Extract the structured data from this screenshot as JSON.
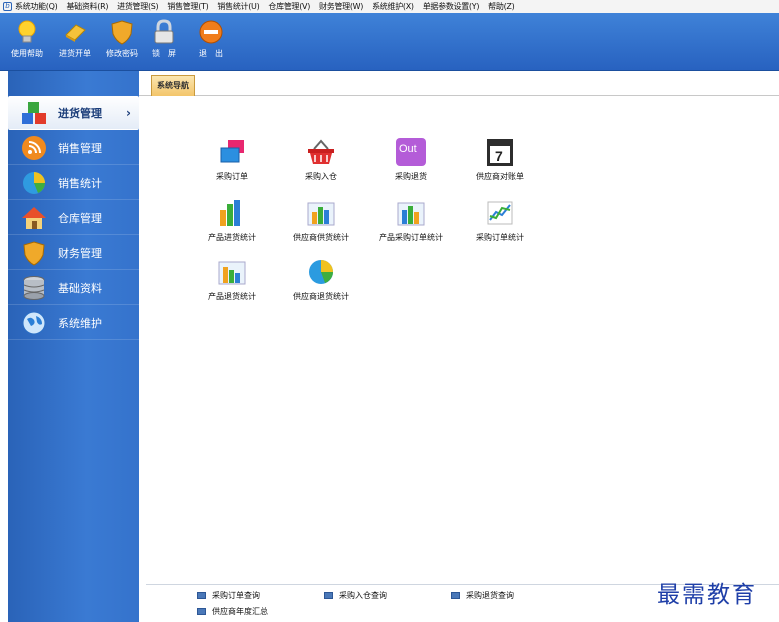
{
  "menubar": {
    "items": [
      "系统功能(Q)",
      "基础资料(R)",
      "进货管理(S)",
      "销售管理(T)",
      "销售统计(U)",
      "仓库管理(V)",
      "财务管理(W)",
      "系统维护(X)",
      "单据参数设置(Y)",
      "帮助(Z)"
    ]
  },
  "toolbar": {
    "help": "使用帮助",
    "billing": "进货开单",
    "change_password": "修改密码",
    "lock": "锁　屏",
    "exit": "退　出"
  },
  "sidebar": {
    "items": [
      {
        "label": "进货管理",
        "icon": "blocks-icon",
        "active": true
      },
      {
        "label": "销售管理",
        "icon": "rss-icon"
      },
      {
        "label": "销售统计",
        "icon": "pie-chart-icon"
      },
      {
        "label": "仓库管理",
        "icon": "house-icon"
      },
      {
        "label": "财务管理",
        "icon": "shield-icon"
      },
      {
        "label": "基础资料",
        "icon": "database-icon"
      },
      {
        "label": "系统维护",
        "icon": "globe-icon"
      }
    ],
    "active_arrow": "›"
  },
  "nav": {
    "tab_label": "系统导航"
  },
  "modules": [
    {
      "label": "采购订单",
      "icon": "order-icon"
    },
    {
      "label": "采购入仓",
      "icon": "basket-icon"
    },
    {
      "label": "采购退货",
      "icon": "out-icon"
    },
    {
      "label": "供应商对账单",
      "icon": "calendar-icon"
    },
    {
      "label": "产品进货统计",
      "icon": "bar-chart-icon"
    },
    {
      "label": "供应商供货统计",
      "icon": "bar-chart-icon"
    },
    {
      "label": "产品采购订单统计",
      "icon": "bar-chart-icon"
    },
    {
      "label": "采购订单统计",
      "icon": "line-chart-icon"
    },
    {
      "label": "产品退货统计",
      "icon": "bar-chart-icon"
    },
    {
      "label": "供应商退货统计",
      "icon": "pie-chart-icon"
    }
  ],
  "calendar_day": "7",
  "out_text": "Out",
  "quick_links": [
    "采购订单查询",
    "采购入仓查询",
    "采购退货查询",
    "供应商年度汇总"
  ],
  "watermark": "最需教育",
  "colors": {
    "toolbar": "#3f82d8",
    "sidebar": "#3573cc",
    "tab": "#f3c56a"
  }
}
